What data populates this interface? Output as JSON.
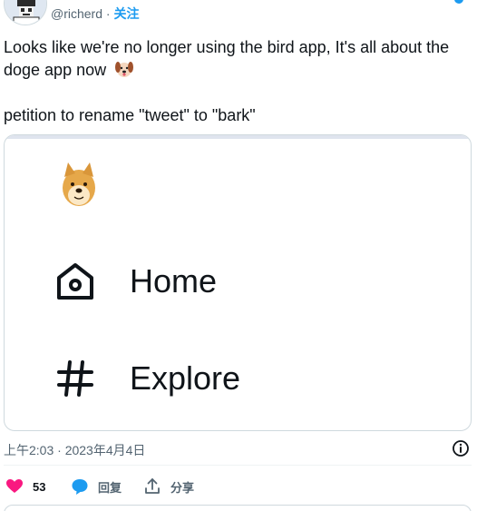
{
  "author": {
    "handle": "@richerd",
    "separator": "·",
    "follow_label": "关注"
  },
  "tweet": {
    "line1": "Looks like we're no longer using the bird app, It's all about the doge app now",
    "line2": "petition to rename \"tweet\" to \"bark\"",
    "emoji_icon": "dog-face-icon"
  },
  "card": {
    "logo_icon": "doge-icon",
    "nav": [
      {
        "label": "Home",
        "icon": "home-icon"
      },
      {
        "label": "Explore",
        "icon": "hashtag-icon"
      }
    ]
  },
  "meta": {
    "timestamp": "上午2:03 · 2023年4月4日"
  },
  "actions": {
    "like_count": "53",
    "reply_label": "回复",
    "share_label": "分享"
  },
  "colors": {
    "accent": "#1d9bf0",
    "like": "#f91880",
    "text": "#0f1419",
    "muted": "#536471"
  }
}
